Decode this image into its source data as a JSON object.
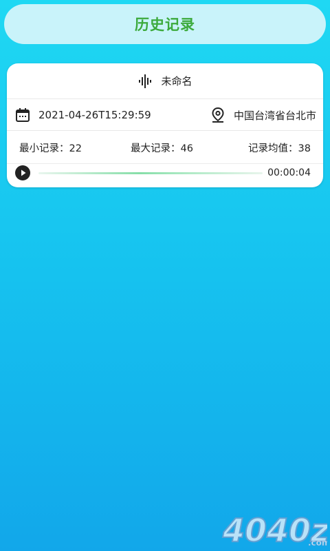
{
  "header": {
    "title": "历史记录"
  },
  "record": {
    "name": "未命名",
    "datetime": "2021-04-26T15:29:59",
    "location": "中国台湾省台北市",
    "stats": {
      "min": "最小记录：22",
      "max": "最大记录：46",
      "avg": "记录均值：38"
    },
    "player": {
      "duration": "00:00:04",
      "progress": 0.0
    }
  },
  "watermark": {
    "text": "4040z",
    "suffix": ".com"
  },
  "icons": {
    "wave": "sound-wave-icon",
    "calendar": "calendar-icon",
    "location": "location-pin-icon",
    "play": "play-icon"
  },
  "colors": {
    "header_title": "#3caa3c",
    "header_bg": "#c9f3fa",
    "progress": "#86dea8"
  }
}
